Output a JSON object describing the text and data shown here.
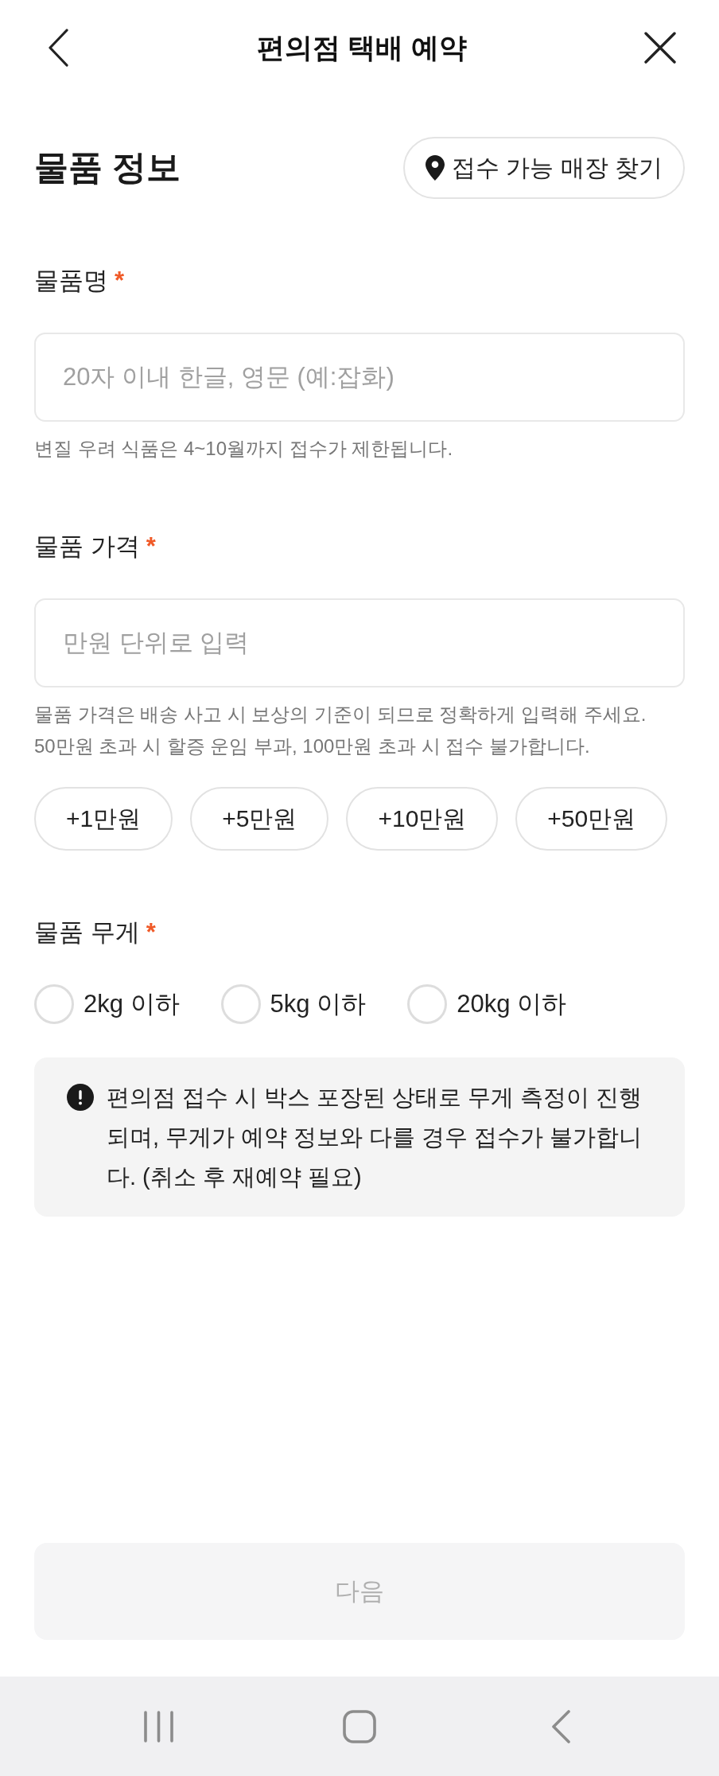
{
  "header": {
    "title": "편의점 택배 예약"
  },
  "section": {
    "title": "물품 정보",
    "store_finder_button": "접수 가능 매장 찾기"
  },
  "fields": [
    {
      "kind": "text",
      "label": "물품명",
      "required_mark": "*",
      "placeholder": "20자 이내 한글, 영문 (예:잡화)",
      "helper": "변질 우려 식품은 4~10월까지 접수가 제한됩니다."
    },
    {
      "kind": "text",
      "label": "물품 가격",
      "required_mark": "*",
      "placeholder": "만원 단위로 입력",
      "helper": "물품 가격은 배송 사고 시 보상의 기준이 되므로 정확하게 입력해 주세요.\n50만원 초과 시 할증 운임 부과, 100만원 초과 시 접수 불가합니다.",
      "quick_amount_buttons": [
        "+1만원",
        "+5만원",
        "+10만원",
        "+50만원"
      ]
    },
    {
      "kind": "radio",
      "label": "물품 무게",
      "required_mark": "*",
      "options": [
        {
          "label": "2kg 이하",
          "selected": false
        },
        {
          "label": "5kg 이하",
          "selected": false
        },
        {
          "label": "20kg 이하",
          "selected": false
        }
      ]
    }
  ],
  "notice": {
    "text": "편의점 접수 시 박스 포장된 상태로 무게 측정이 진행되며, 무게가 예약 정보와 다를 경우 접수가 불가합니다. (취소 후 재예약 필요)"
  },
  "next_button": {
    "label": "다음",
    "disabled": true
  }
}
